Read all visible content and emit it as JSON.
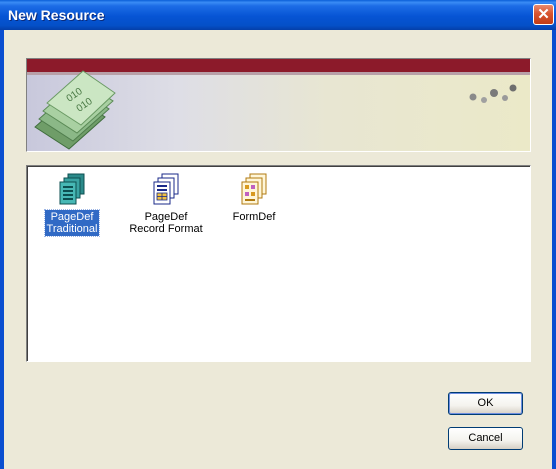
{
  "window": {
    "title": "New Resource",
    "close_glyph": "✕"
  },
  "banner": {
    "art_icon": "money-bills-icon",
    "dots_icon": "dots-decoration-icon",
    "stripe_color": "#8c1a2a"
  },
  "resources": {
    "items": [
      {
        "label": "PageDef\nTraditional",
        "icon": "pagedef-traditional-icon",
        "selected": true
      },
      {
        "label": "PageDef\nRecord Format",
        "icon": "pagedef-record-format-icon",
        "selected": false
      },
      {
        "label": "FormDef",
        "icon": "formdef-icon",
        "selected": false
      }
    ]
  },
  "buttons": {
    "ok_label": "OK",
    "cancel_label": "Cancel"
  },
  "colors": {
    "selection": "#316ac5",
    "titlebar": "#0654d4",
    "face": "#ece9d8"
  }
}
